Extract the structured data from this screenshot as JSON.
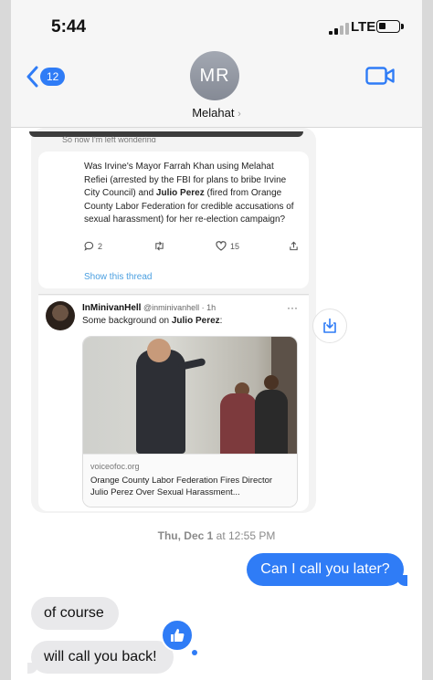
{
  "status_bar": {
    "time": "5:44",
    "network": "LTE"
  },
  "header": {
    "back_badge": "12",
    "avatar_initials": "MR",
    "contact_name": "Melahat",
    "contact_chevron": "›"
  },
  "thread": {
    "clipped_line": "So now I'm left wondering",
    "tweet1": {
      "text_a": "Was Irvine's Mayor Farrah Khan using Melahat Refiei (arrested by the FBI for plans to bribe Irvine City Council) and ",
      "text_bold": "Julio Perez",
      "text_b": " (fired from Orange County Labor Federation for credible accusations of sexual harassment) for her re-election campaign?",
      "replies": "2",
      "likes": "15",
      "show_thread": "Show this thread"
    },
    "tweet2": {
      "display_name": "InMinivanHell",
      "handle_time": "@inminivanhell · 1h",
      "text_a": "Some background on ",
      "text_bold": "Julio Perez",
      "text_b": ":",
      "more": "···",
      "link_domain": "voiceofoc.org",
      "link_title": "Orange County Labor Federation Fires Director Julio Perez Over Sexual Harassment..."
    }
  },
  "timestamp": {
    "day": "Thu, Dec 1",
    "rest": " at 12:55 PM"
  },
  "messages": {
    "outgoing_1": "Can I call you later?",
    "incoming_1": "of course",
    "incoming_2": "will call you back!"
  },
  "icons": {
    "back": "chevron-left-icon",
    "video": "video-camera-icon",
    "reply": "comment-icon",
    "retweet": "retweet-icon",
    "like": "heart-icon",
    "share": "share-icon",
    "download": "download-icon",
    "tapback": "thumbs-up-icon"
  },
  "colors": {
    "accent": "#2f7cf6",
    "incoming_bubble": "#e9e9eb",
    "link": "#4a9fe0"
  }
}
